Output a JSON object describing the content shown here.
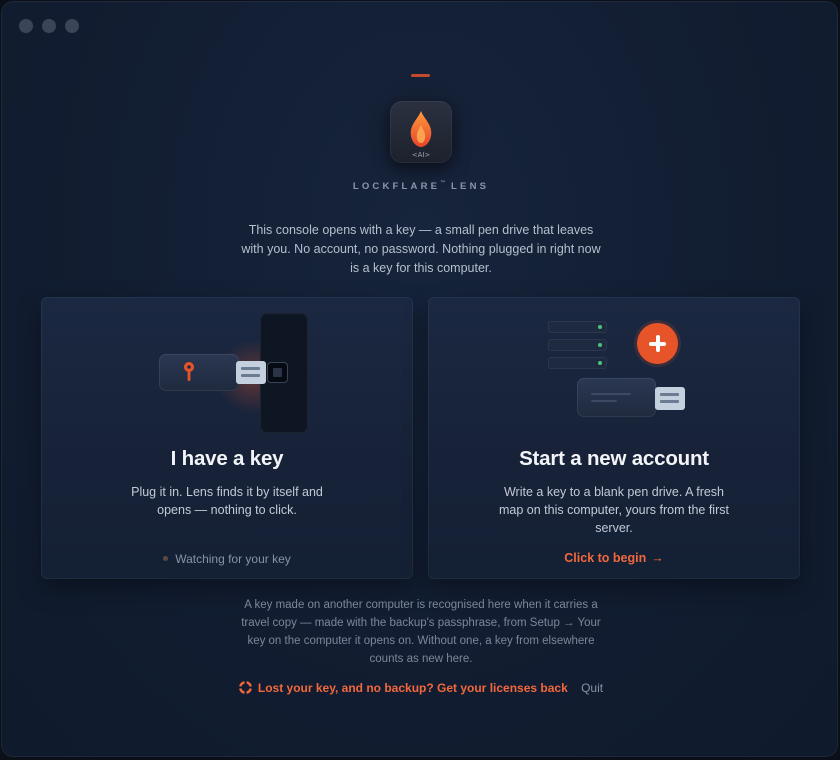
{
  "window": {
    "traffic_lights": [
      "close",
      "minimize",
      "zoom"
    ],
    "colors": {
      "background": "#121d31",
      "accent": "#e8542a",
      "server_led": "#4ec27a"
    }
  },
  "header": {
    "logo_icon": "flame-icon",
    "logo_badge": "<AI>",
    "brand": "LOCKFLARE",
    "brand_tm": "™",
    "brand_suffix": "LENS",
    "intro": "This console opens with a key — a small pen drive that leaves with you. No account, no password. Nothing plugged in right now is a key for this computer."
  },
  "cards": {
    "have_key": {
      "icon": "usb-key-icon",
      "title": "I have a key",
      "description": "Plug it in. Lens finds it by itself and opens — nothing to click.",
      "status": "Watching for your key"
    },
    "new_account": {
      "icon": "new-server-icon",
      "title": "Start a new account",
      "description": "Write a key to a blank pen drive. A fresh map on this computer, yours from the first server.",
      "action": "Click to begin",
      "action_arrow": "→"
    }
  },
  "footer": {
    "note": "A key made on another computer is recognised here when it carries a travel copy — made with the backup's passphrase, from Setup → Your key on the computer it opens on. Without one, a key from elsewhere counts as new here.",
    "recover_icon": "lifebuoy-icon",
    "recover_link": "Lost your key, and no backup? Get your licenses back",
    "quit": "Quit"
  }
}
